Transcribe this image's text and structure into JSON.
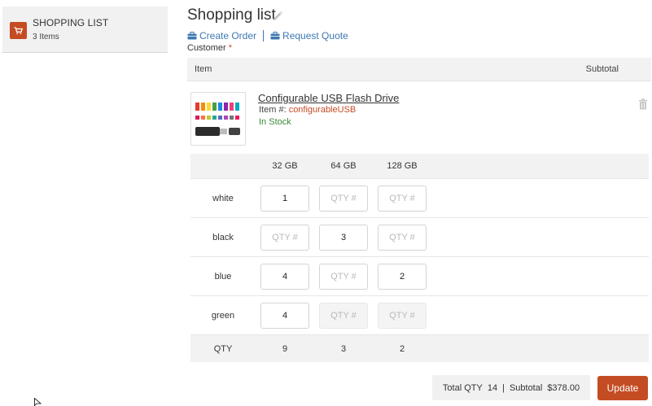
{
  "sidebar": {
    "title": "SHOPPING LIST",
    "count": "3 Items",
    "icon": "cart-icon"
  },
  "header": {
    "title": "Shopping list",
    "create_order": "Create Order",
    "request_quote": "Request Quote",
    "customer_label": "Customer",
    "required_mark": "*"
  },
  "table": {
    "col_item": "Item",
    "col_subtotal": "Subtotal"
  },
  "product": {
    "name": "Configurable USB Flash Drive",
    "sku_label": "Item #:",
    "sku": "configurableUSB",
    "stock": "In Stock"
  },
  "matrix": {
    "columns": [
      "32 GB",
      "64 GB",
      "128 GB"
    ],
    "placeholder": "QTY #",
    "rows": [
      {
        "label": "white",
        "values": [
          "1",
          "",
          ""
        ],
        "disabled": [
          false,
          false,
          false
        ]
      },
      {
        "label": "black",
        "values": [
          "",
          "3",
          ""
        ],
        "disabled": [
          false,
          false,
          false
        ]
      },
      {
        "label": "blue",
        "values": [
          "4",
          "",
          "2"
        ],
        "disabled": [
          false,
          false,
          false
        ]
      },
      {
        "label": "green",
        "values": [
          "4",
          "",
          ""
        ],
        "disabled": [
          false,
          true,
          true
        ]
      }
    ],
    "total_label": "QTY",
    "totals": [
      "9",
      "3",
      "2"
    ]
  },
  "summary": {
    "total_qty_label": "Total QTY",
    "total_qty": "14",
    "separator": "|",
    "subtotal_label": "Subtotal",
    "subtotal": "$378.00",
    "update": "Update"
  },
  "colors": {
    "accent": "#c44c23",
    "link": "#3e78b2",
    "in_stock": "#3a8a3a"
  }
}
